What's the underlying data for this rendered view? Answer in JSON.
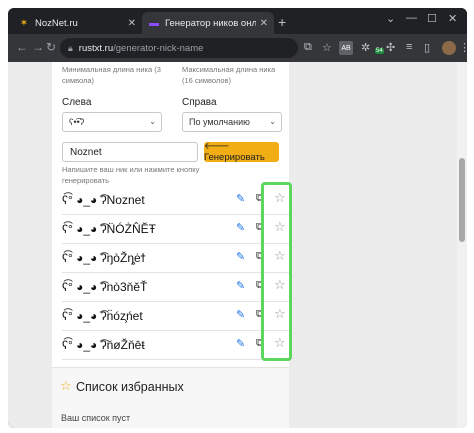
{
  "browser": {
    "tabs": [
      {
        "title": "NozNet.ru",
        "icon": "noznet-favicon"
      },
      {
        "title": "Генератор ников онлайн",
        "icon": "rustxt-favicon"
      }
    ],
    "new_tab": "+",
    "url_host": "rustxt.ru",
    "url_path": "/generator-nick-name",
    "ext_ab": "AB",
    "ext_badge": "54"
  },
  "form": {
    "min_len_hint": "Минимальная длина ника (3 символа)",
    "max_len_hint": "Максимальная длина ника (16 символов)",
    "left_label": "Слева",
    "left_value": "ʕ•͡•ʔ",
    "right_label": "Справа",
    "right_value": "По умолчанию",
    "nick_value": "Noznet",
    "generate_label": "🡐 Генерировать",
    "hint": "Напишите ваш ник или нажмите кнопку генерировать"
  },
  "results": [
    {
      "nick": "ʕ͡° ◕_◕ ͡ʔNoznet"
    },
    {
      "nick": "ʕ͡° ◕_◕ ͡ʔN̈ÓŻN̂ĔŦ"
    },
    {
      "nick": "ʕ͡° ◕_◕ ͡ʔŋòŽŋ̧ėϯ"
    },
    {
      "nick": "ʕ͡° ◕_◕ ͡ʔnò3ňĕŤ"
    },
    {
      "nick": "ʕ͡° ◕_◕ ͡ʔn̈óz̧ńet"
    },
    {
      "nick": "ʕ͡° ◕_◕ ͡ʔňøŽňēŧ"
    }
  ],
  "favorites": {
    "title": "Список избранных",
    "empty": "Ваш список пуст"
  },
  "colors": {
    "accent": "#f0ad14",
    "highlight": "#5cd65c",
    "edit_icon": "#1a73e8"
  }
}
